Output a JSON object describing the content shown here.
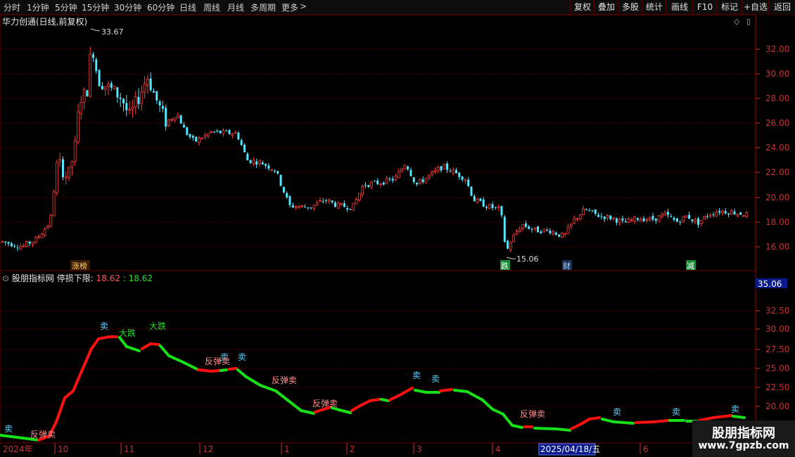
{
  "toolbar": {
    "periods": [
      {
        "label": "分时",
        "active": false
      },
      {
        "label": "1分钟",
        "active": false
      },
      {
        "label": "5分钟",
        "active": false
      },
      {
        "label": "15分钟",
        "active": false
      },
      {
        "label": "30分钟",
        "active": false
      },
      {
        "label": "60分钟",
        "active": false
      },
      {
        "label": "日线",
        "active": true
      },
      {
        "label": "周线",
        "active": false
      },
      {
        "label": "月线",
        "active": false
      },
      {
        "label": "多周期",
        "active": false
      },
      {
        "label": "更多",
        "active": false
      }
    ],
    "more_arrow": ">",
    "actions": [
      "复权",
      "叠加",
      "多股",
      "统计",
      "画线",
      "F10",
      "标记",
      "+自选",
      "返回"
    ]
  },
  "stock_title": "华力创通(日线,前复权)",
  "indicator": {
    "name": "股朋指标网",
    "label": "停损下限:",
    "value": "18.62",
    "value2": ": 18.62"
  },
  "price_axis": {
    "labels": [
      "32.00",
      "30.00",
      "28.00",
      "26.00",
      "24.00",
      "22.00",
      "20.00",
      "18.00",
      "16.00"
    ],
    "high_label": "33.67",
    "low_label": "15.06"
  },
  "indicator_axis": {
    "labels": [
      "32.50",
      "30.00",
      "27.50",
      "25.00",
      "22.50",
      "20.00"
    ],
    "highlight": "35.06"
  },
  "time_axis": {
    "labels": [
      "2024年",
      "10",
      "11",
      "12",
      "1",
      "2",
      "3",
      "4",
      "6"
    ],
    "date_box": "2025/04/18/五"
  },
  "markers": [
    "涨榜",
    "跌",
    "财",
    "减"
  ],
  "signals": [
    "卖",
    "卖",
    "卖",
    "卖",
    "卖",
    "卖",
    "卖",
    "卖",
    "大跌",
    "大跌",
    "反弹卖",
    "反弹卖",
    "反弹卖",
    "反弹卖",
    "反弹卖"
  ],
  "colors": {
    "up": "#ff3b3b",
    "down": "#54e6ff",
    "stop_up": "#ff1010",
    "stop_down": "#18e018",
    "grid": "#6a0000"
  },
  "watermark": {
    "line1": "股朋指标网",
    "line2": "www.7gpzb.com"
  }
}
